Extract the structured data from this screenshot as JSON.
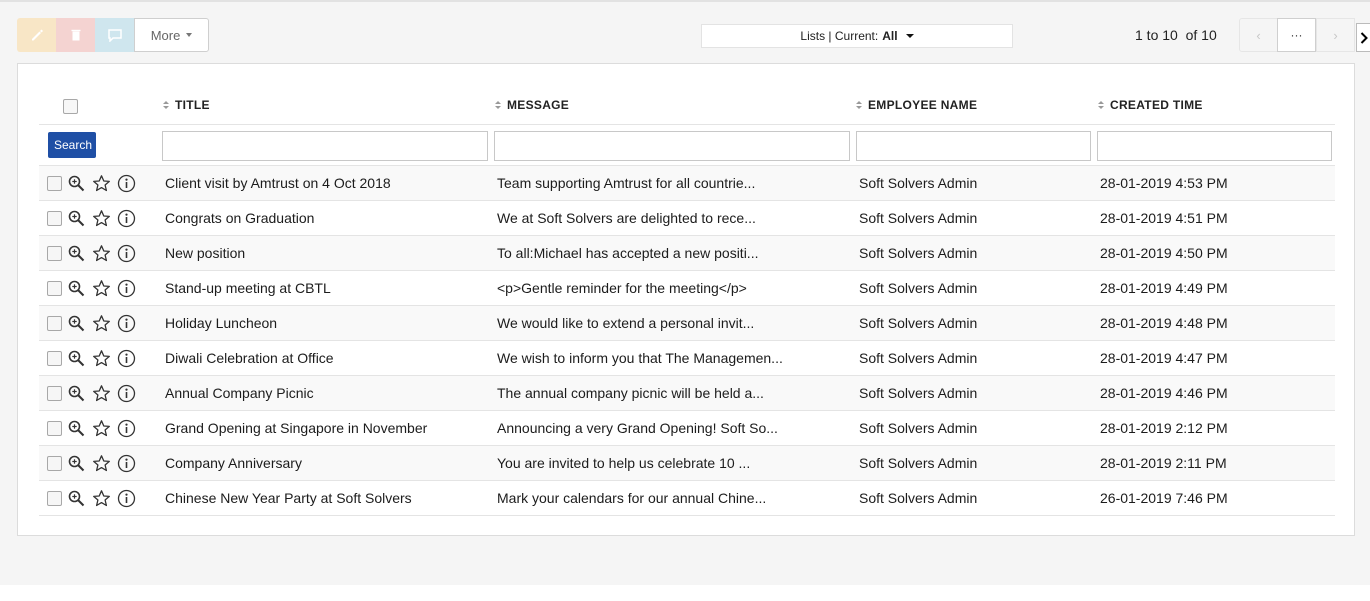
{
  "toolbar": {
    "edit_icon": "pencil-icon",
    "delete_icon": "trash-icon",
    "comment_icon": "comment-icon",
    "more_label": "More",
    "colors": {
      "edit": "#f8e6c6",
      "delete": "#f4d3d1",
      "comment": "#cfe6ee"
    }
  },
  "lists": {
    "prefix": "Lists | Current:",
    "current": "All"
  },
  "pager": {
    "text": "1 to 10  of 10",
    "prev": "‹",
    "ellipsis": "···",
    "next": "›"
  },
  "table": {
    "columns": [
      "TITLE",
      "MESSAGE",
      "EMPLOYEE NAME",
      "CREATED TIME"
    ],
    "search_label": "Search",
    "rows": [
      {
        "title": "Client visit by Amtrust on 4 Oct 2018",
        "message": "Team supporting Amtrust for all countrie...",
        "employee": "Soft Solvers Admin",
        "created": "28-01-2019 4:53 PM"
      },
      {
        "title": "Congrats on Graduation",
        "message": "We at Soft Solvers are delighted to rece...",
        "employee": "Soft Solvers Admin",
        "created": "28-01-2019 4:51 PM"
      },
      {
        "title": "New position",
        "message": "To all:Michael has accepted a new positi...",
        "employee": "Soft Solvers Admin",
        "created": "28-01-2019 4:50 PM"
      },
      {
        "title": "Stand-up meeting at CBTL",
        "message": "<p>Gentle reminder for the meeting</p>",
        "employee": "Soft Solvers Admin",
        "created": "28-01-2019 4:49 PM"
      },
      {
        "title": "Holiday Luncheon",
        "message": "We would like to extend a personal invit...",
        "employee": "Soft Solvers Admin",
        "created": "28-01-2019 4:48 PM"
      },
      {
        "title": "Diwali Celebration at Office",
        "message": "We wish to inform you that The Managemen...",
        "employee": "Soft Solvers Admin",
        "created": "28-01-2019 4:47 PM"
      },
      {
        "title": "Annual Company Picnic",
        "message": "The annual company picnic will be held a...",
        "employee": "Soft Solvers Admin",
        "created": "28-01-2019 4:46 PM"
      },
      {
        "title": "Grand Opening at Singapore in November",
        "message": "Announcing a very Grand Opening! Soft So...",
        "employee": "Soft Solvers Admin",
        "created": "28-01-2019 2:12 PM"
      },
      {
        "title": "Company Anniversary",
        "message": "You are invited to help us celebrate 10 ...",
        "employee": "Soft Solvers Admin",
        "created": "28-01-2019 2:11 PM"
      },
      {
        "title": "Chinese New Year Party at Soft Solvers",
        "message": "Mark your calendars for our annual Chine...",
        "employee": "Soft Solvers Admin",
        "created": "26-01-2019 7:46 PM"
      }
    ]
  }
}
